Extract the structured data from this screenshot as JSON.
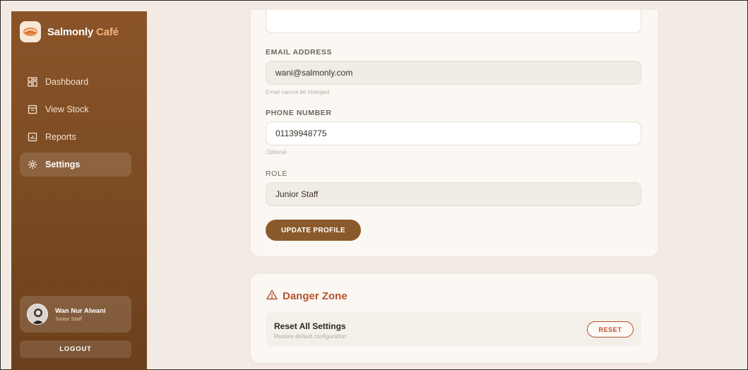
{
  "brand": {
    "name": "Salmonly",
    "accent": "Café"
  },
  "nav": {
    "items": [
      {
        "label": "Dashboard",
        "icon": "dashboard-icon"
      },
      {
        "label": "View Stock",
        "icon": "archive-icon"
      },
      {
        "label": "Reports",
        "icon": "chart-icon"
      },
      {
        "label": "Settings",
        "icon": "gear-icon",
        "active": true
      }
    ]
  },
  "user": {
    "name": "Wan Nur Alwani",
    "role": "Junior Staff"
  },
  "logout_label": "LOGOUT",
  "profile": {
    "email_label": "EMAIL ADDRESS",
    "email_value": "wani@salmonly.com",
    "email_hint": "Email cannot be changed",
    "phone_label": "PHONE NUMBER",
    "phone_value": "01139948775",
    "phone_hint": "Optional",
    "role_label": "ROLE",
    "role_value": "Junior Staff",
    "update_label": "UPDATE PROFILE"
  },
  "danger": {
    "title": "Danger Zone",
    "reset_title": "Reset All Settings",
    "reset_subtitle": "Restore default configuration",
    "reset_label": "RESET"
  },
  "colors": {
    "sidebar": "#7a4a22",
    "primary_button": "#8b5a2b",
    "danger": "#b5532f",
    "background": "#f3ebe3"
  }
}
